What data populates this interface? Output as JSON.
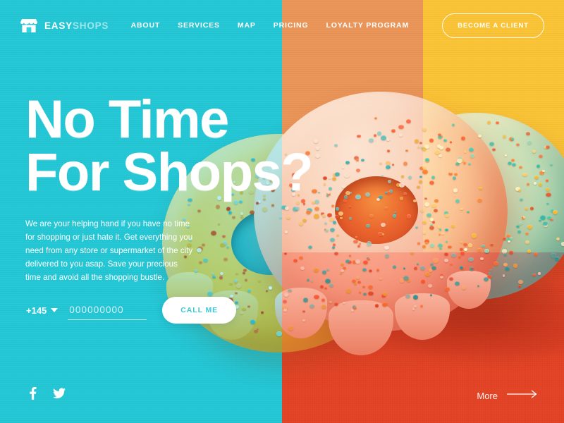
{
  "brand": {
    "logo_icon": "storefront-icon",
    "name_bold": "EASY",
    "name_light": "SHOPS"
  },
  "header": {
    "nav": [
      {
        "label": "ABOUT",
        "name": "nav-item-about"
      },
      {
        "label": "SERVICES",
        "name": "nav-item-services"
      },
      {
        "label": "MAP",
        "name": "nav-item-map"
      },
      {
        "label": "PRICING",
        "name": "nav-item-pricing"
      },
      {
        "label": "LOYALTY PROGRAM",
        "name": "nav-item-loyalty-program"
      }
    ],
    "cta_label": "BECOME A CLIENT"
  },
  "hero": {
    "headline": "No Time\nFor Shops?",
    "paragraph": "We are your helping hand if you have no time for shopping or just hate it. Get everything you need from any store or supermarket of the city delivered to you asap. Save your precious time and avoid all the shopping bustle."
  },
  "form": {
    "country_code": "+145",
    "country_code_caret": "chevron-down-icon",
    "phone_value": "",
    "phone_placeholder": "000000000",
    "submit_label": "CALL ME"
  },
  "footer": {
    "socials": [
      {
        "label": "Facebook",
        "icon": "facebook-icon"
      },
      {
        "label": "Twitter",
        "icon": "twitter-icon"
      }
    ],
    "more_label": "More",
    "more_icon": "arrow-right-icon"
  },
  "artwork": {
    "subject": "3d-donuts-with-sprinkles"
  },
  "colors": {
    "cyan": "#32D4E0",
    "salmon": "#EFA76B",
    "yellow": "#FBCF45",
    "coral": "#E85B38",
    "white": "#FFFFFF",
    "button_text": "#3AC9D4"
  }
}
